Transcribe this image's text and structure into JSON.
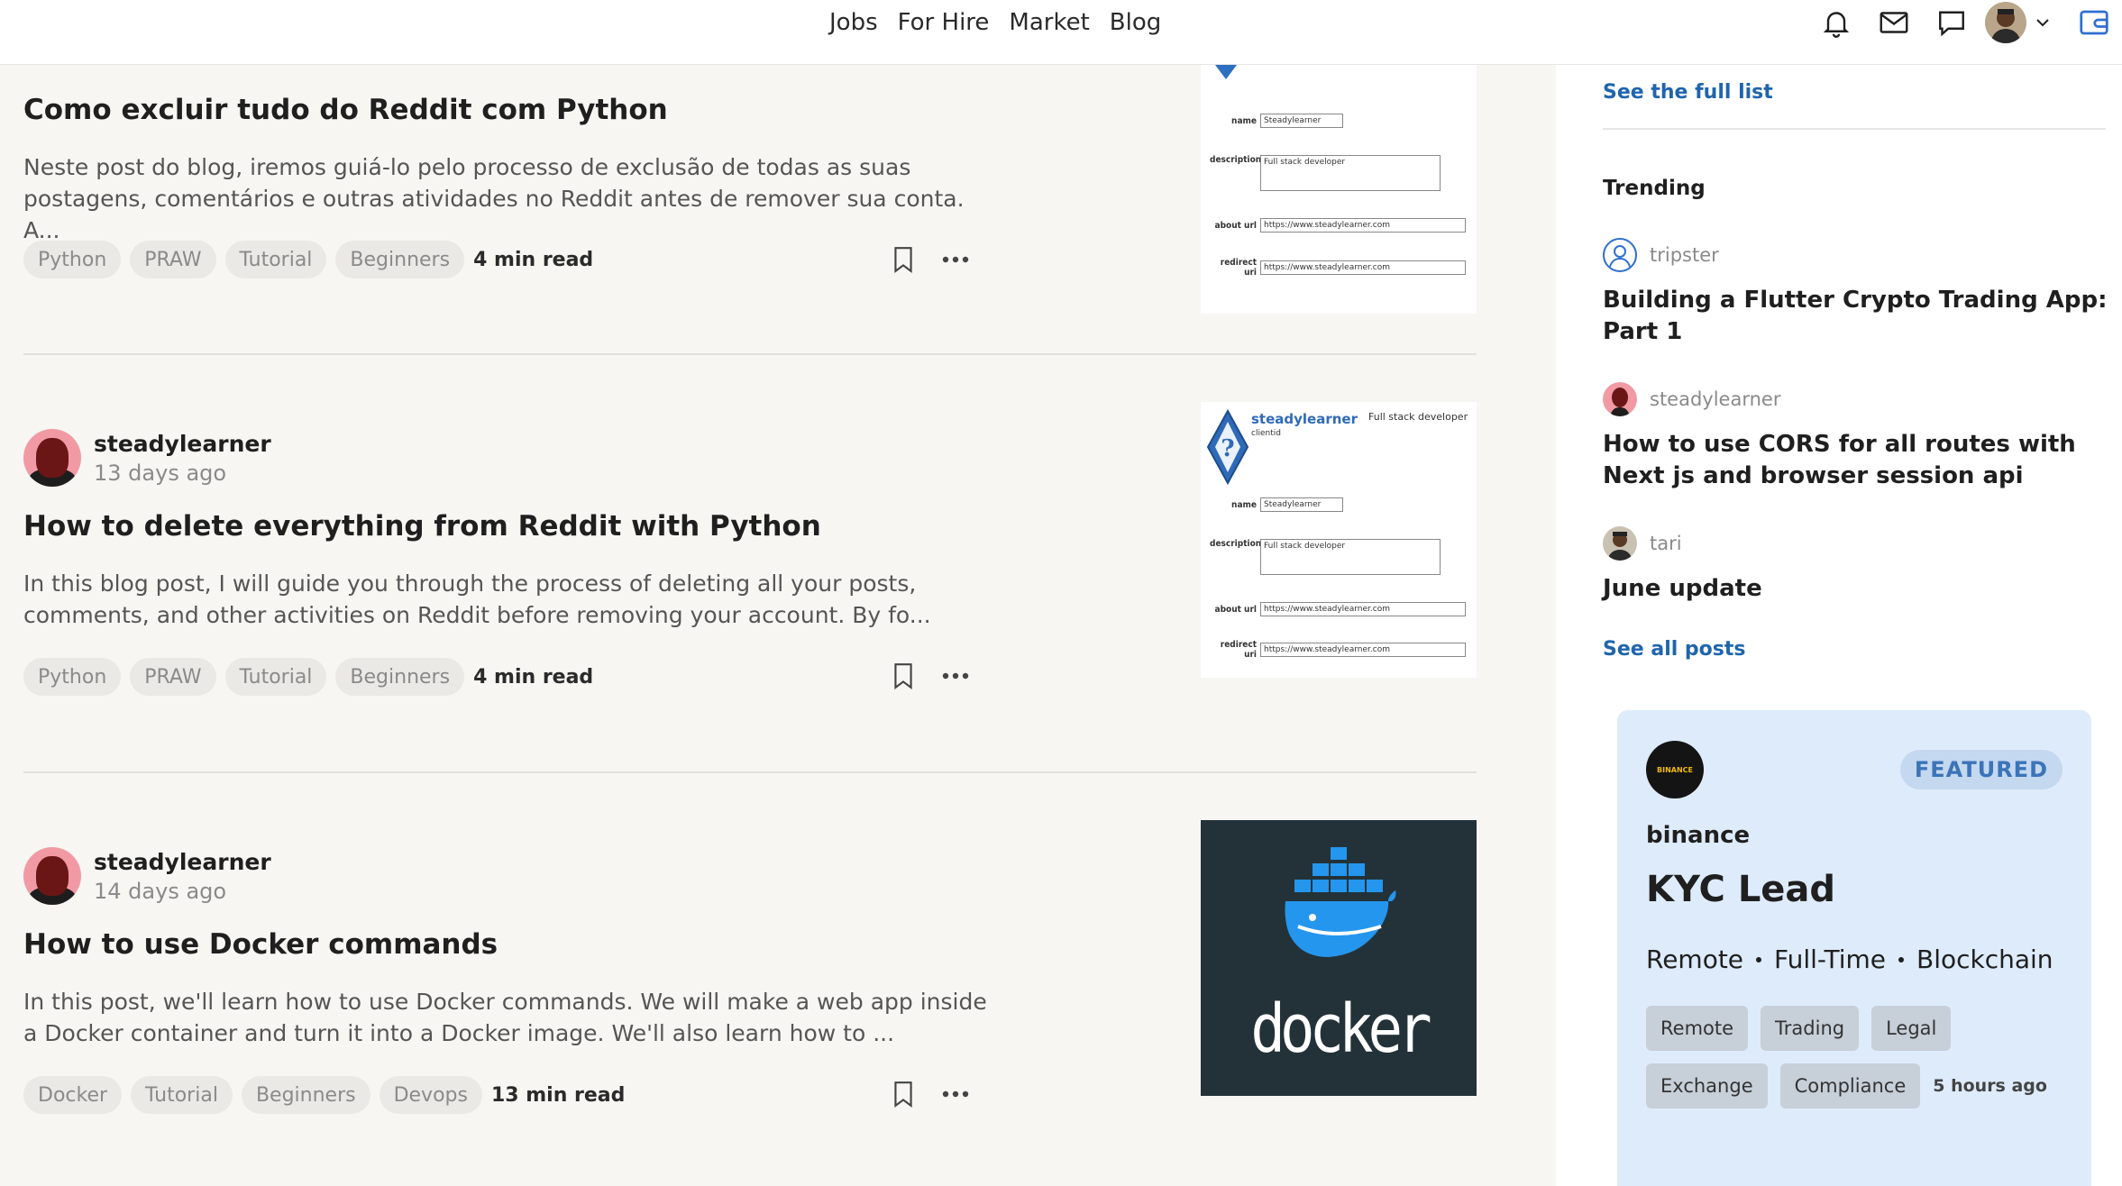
{
  "nav": {
    "jobs": "Jobs",
    "for_hire": "For Hire",
    "market": "Market",
    "blog": "Blog"
  },
  "posts": [
    {
      "author": "",
      "time": "",
      "title": "Como excluir tudo do Reddit com Python",
      "excerpt": "Neste post do blog, iremos guiá-lo pelo processo de exclusão de todas as suas postagens, comentários e outras atividades no Reddit antes de remover sua conta. A...",
      "tags": [
        "Python",
        "PRAW",
        "Tutorial",
        "Beginners"
      ],
      "read_time": "4 min read"
    },
    {
      "author": "steadylearner",
      "time": "13 days ago",
      "title": "How to delete everything from Reddit with Python",
      "excerpt": "In this blog post, I will guide you through the process of deleting all your posts, comments, and other activities on Reddit before removing your account. By fo...",
      "tags": [
        "Python",
        "PRAW",
        "Tutorial",
        "Beginners"
      ],
      "read_time": "4 min read"
    },
    {
      "author": "steadylearner",
      "time": "14 days ago",
      "title": "How to use Docker commands",
      "excerpt": "In this post, we'll learn how to use Docker commands. We will make a web app inside a Docker container and turn it into a Docker image. We'll also learn how to ...",
      "tags": [
        "Docker",
        "Tutorial",
        "Beginners",
        "Devops"
      ],
      "read_time": "13 min read"
    }
  ],
  "thumb_form": {
    "brand": "steadylearner",
    "clientid": "clientid",
    "role": "Full stack developer",
    "name_label": "name",
    "name_value": "Steadylearner",
    "description_label": "description",
    "description_value": "Full stack developer",
    "about_label": "about url",
    "about_value": "https://www.steadylearner.com",
    "redirect_label": "redirect uri",
    "redirect_value": "https://www.steadylearner.com"
  },
  "docker_word": "docker",
  "sidebar": {
    "see_full_list": "See the full list",
    "trending_heading": "Trending",
    "trending": [
      {
        "author": "tripster",
        "title": "Building a Flutter Crypto Trading App: Part 1"
      },
      {
        "author": "steadylearner",
        "title": "How to use CORS for all routes with Next js and browser session api"
      },
      {
        "author": "tari",
        "title": "June update"
      }
    ],
    "see_all_posts": "See all posts"
  },
  "job": {
    "logo_text": "BINANCE",
    "featured": "FEATURED",
    "company": "binance",
    "title": "KYC Lead",
    "meta": [
      "Remote",
      "Full-Time",
      "Blockchain"
    ],
    "tags": [
      "Remote",
      "Trading",
      "Legal",
      "Exchange",
      "Compliance"
    ],
    "posted": "5 hours ago"
  },
  "colors": {
    "link": "#1f65ad",
    "card_bg": "#deebfb",
    "featured_text": "#3b74b8",
    "accent": "#2f6fd1"
  }
}
